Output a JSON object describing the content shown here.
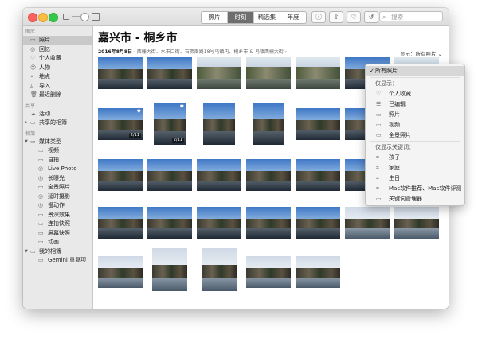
{
  "toolbar": {
    "tabs": [
      "照片",
      "时刻",
      "精选集",
      "年度"
    ],
    "active_tab": 1,
    "info_icon": "ⓘ",
    "share_icon": "⇪",
    "heart_icon": "♡",
    "rotate_icon": "↺",
    "search_placeholder": "搜索",
    "search_icon": "⌕"
  },
  "sidebar": {
    "sections": [
      {
        "header": "图库",
        "items": [
          {
            "label": "照片",
            "icon": "▭",
            "selected": true,
            "sub": false
          },
          {
            "label": "回忆",
            "icon": "◎",
            "selected": false,
            "sub": false
          },
          {
            "label": "个人收藏",
            "icon": "♡",
            "selected": false,
            "sub": false
          },
          {
            "label": "人物",
            "icon": "☺",
            "selected": false,
            "sub": false
          },
          {
            "label": "地点",
            "icon": "⌖",
            "selected": false,
            "sub": false
          },
          {
            "label": "导入",
            "icon": "⤓",
            "selected": false,
            "sub": false
          },
          {
            "label": "最近删除",
            "icon": "🗑",
            "selected": false,
            "sub": false
          }
        ]
      },
      {
        "header": "共享",
        "items": [
          {
            "label": "活动",
            "icon": "☁",
            "selected": false,
            "sub": false
          },
          {
            "label": "共享的相簿",
            "icon": "▭",
            "selected": false,
            "sub": false,
            "disclosure": "▶"
          }
        ]
      },
      {
        "header": "相簿",
        "items": [
          {
            "label": "媒体类型",
            "icon": "▭",
            "selected": false,
            "sub": false,
            "disclosure": "▼"
          },
          {
            "label": "视频",
            "icon": "▭",
            "selected": false,
            "sub": true
          },
          {
            "label": "自拍",
            "icon": "▭",
            "selected": false,
            "sub": true
          },
          {
            "label": "Live Photo",
            "icon": "◎",
            "selected": false,
            "sub": true
          },
          {
            "label": "长曝光",
            "icon": "◎",
            "selected": false,
            "sub": true
          },
          {
            "label": "全景照片",
            "icon": "▭",
            "selected": false,
            "sub": true
          },
          {
            "label": "延时摄影",
            "icon": "◎",
            "selected": false,
            "sub": true
          },
          {
            "label": "慢动作",
            "icon": "◎",
            "selected": false,
            "sub": true
          },
          {
            "label": "景深效果",
            "icon": "▭",
            "selected": false,
            "sub": true
          },
          {
            "label": "连拍快照",
            "icon": "▭",
            "selected": false,
            "sub": true
          },
          {
            "label": "屏幕快照",
            "icon": "▭",
            "selected": false,
            "sub": true
          },
          {
            "label": "动画",
            "icon": "▭",
            "selected": false,
            "sub": true
          },
          {
            "label": "我的相簿",
            "icon": "▭",
            "selected": false,
            "sub": false,
            "disclosure": "▼"
          },
          {
            "label": "Gemini 重复项",
            "icon": "▭",
            "selected": false,
            "sub": true
          }
        ]
      }
    ]
  },
  "main": {
    "title": "嘉兴市 - 桐乡市",
    "date": "2016年8月8日",
    "places": "· 西栅大街、水市口街、石佛南路18号乌镇内、桐乡市 & 乌镇西栅大街 ›",
    "filter_label": "显示：",
    "filter_value": "所有照片",
    "filter_chevron": "⌄",
    "photos": [
      {
        "style": "sunset",
        "badge": "",
        "heart": false,
        "selected": false
      },
      {
        "style": "sunset",
        "badge": "",
        "heart": false,
        "selected": false
      },
      {
        "style": "bridge",
        "badge": "",
        "heart": false,
        "selected": false
      },
      {
        "style": "bridge",
        "badge": "",
        "heart": false,
        "selected": false
      },
      {
        "style": "bridge",
        "badge": "",
        "heart": false,
        "selected": false
      },
      {
        "style": "sunset",
        "badge": "",
        "heart": false,
        "selected": false
      },
      {
        "style": "bridge",
        "badge": "",
        "heart": false,
        "selected": false
      },
      {
        "style": "sunset",
        "badge": "2/11",
        "heart": true,
        "selected": false
      },
      {
        "style": "sunset",
        "badge": "2/11",
        "heart": true,
        "selected": false
      },
      {
        "style": "sunset",
        "badge": "",
        "heart": false,
        "selected": false
      },
      {
        "style": "sunset",
        "badge": "",
        "heart": false,
        "selected": false
      },
      {
        "style": "sunset",
        "badge": "",
        "heart": false,
        "selected": false
      },
      {
        "style": "sunset",
        "badge": "",
        "heart": false,
        "selected": false
      },
      {
        "style": "sunset",
        "badge": "",
        "heart": false,
        "selected": true
      },
      {
        "style": "sunset",
        "badge": "",
        "heart": false,
        "selected": false
      },
      {
        "style": "sunset",
        "badge": "",
        "heart": false,
        "selected": false
      },
      {
        "style": "sunset",
        "badge": "",
        "heart": false,
        "selected": false
      },
      {
        "style": "sunset",
        "badge": "",
        "heart": false,
        "selected": false
      },
      {
        "style": "sunset",
        "badge": "",
        "heart": false,
        "selected": false
      },
      {
        "style": "sunset",
        "badge": "",
        "heart": false,
        "selected": false
      },
      {
        "style": "sunset",
        "badge": "",
        "heart": false,
        "selected": false
      },
      {
        "style": "sunset",
        "badge": "",
        "heart": false,
        "selected": false
      },
      {
        "style": "sunset",
        "badge": "",
        "heart": false,
        "selected": false
      },
      {
        "style": "sunset",
        "badge": "",
        "heart": false,
        "selected": false
      },
      {
        "style": "sunset",
        "badge": "",
        "heart": false,
        "selected": false
      },
      {
        "style": "sunset",
        "badge": "",
        "heart": false,
        "selected": false
      },
      {
        "style": "pale",
        "badge": "",
        "heart": false,
        "selected": false
      },
      {
        "style": "pale",
        "badge": "",
        "heart": false,
        "selected": false
      },
      {
        "style": "pale",
        "badge": "",
        "heart": false,
        "selected": false
      },
      {
        "style": "pale",
        "badge": "",
        "heart": false,
        "selected": false
      },
      {
        "style": "pale",
        "badge": "",
        "heart": false,
        "selected": false
      },
      {
        "style": "pale",
        "badge": "",
        "heart": false,
        "selected": false
      },
      {
        "style": "pale",
        "badge": "",
        "heart": false,
        "selected": false
      }
    ]
  },
  "dropdown": {
    "checkmark": "✓",
    "all_photos": "所有照片",
    "show_only_header": "仅显示：",
    "show_only_items": [
      {
        "label": "个人收藏",
        "icon": "♡"
      },
      {
        "label": "已编辑",
        "icon": "☰"
      },
      {
        "label": "照片",
        "icon": "▭"
      },
      {
        "label": "视频",
        "icon": "▭"
      },
      {
        "label": "全景照片",
        "icon": "▭"
      }
    ],
    "keyword_header": "仅显示关键词：",
    "keyword_items": [
      {
        "label": "孩子",
        "icon": "⌗"
      },
      {
        "label": "家庭",
        "icon": "⌗"
      },
      {
        "label": "生日",
        "icon": "⌗"
      },
      {
        "label": "Mac软件推荐、Mac软件评测",
        "icon": "⌗"
      },
      {
        "label": "关键词管理器...",
        "icon": "▭"
      }
    ]
  }
}
